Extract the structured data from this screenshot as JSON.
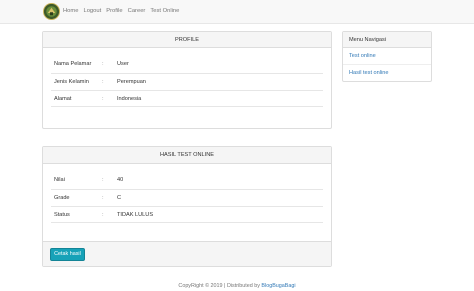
{
  "navbar": {
    "links": [
      "Home",
      "Logout",
      "Profile",
      "Career",
      "Test Online"
    ]
  },
  "profile": {
    "title": "PROFILE",
    "separator": ":",
    "rows": [
      {
        "label": "Nama Pelamar",
        "value": "User"
      },
      {
        "label": "Jenis Kelamin",
        "value": "Perempuan"
      },
      {
        "label": "Alamat",
        "value": "Indonesia"
      }
    ]
  },
  "result": {
    "title": "HASIL TEST ONLINE",
    "separator": ":",
    "rows": [
      {
        "label": "Nilai",
        "value": "40"
      },
      {
        "label": "Grade",
        "value": "C"
      },
      {
        "label": "Status",
        "value": "TIDAK LULUS"
      }
    ],
    "print_button": "Cetak hasil"
  },
  "sidebar": {
    "title": "Menu Navigasi",
    "items": [
      "Test online",
      "Hasil test online"
    ]
  },
  "footer": {
    "text": "CopyRight © 2019 | Distributed by ",
    "link": "BlogBugaBagi"
  },
  "colors": {
    "accent": "#17a2b8",
    "link": "#337ab7"
  }
}
